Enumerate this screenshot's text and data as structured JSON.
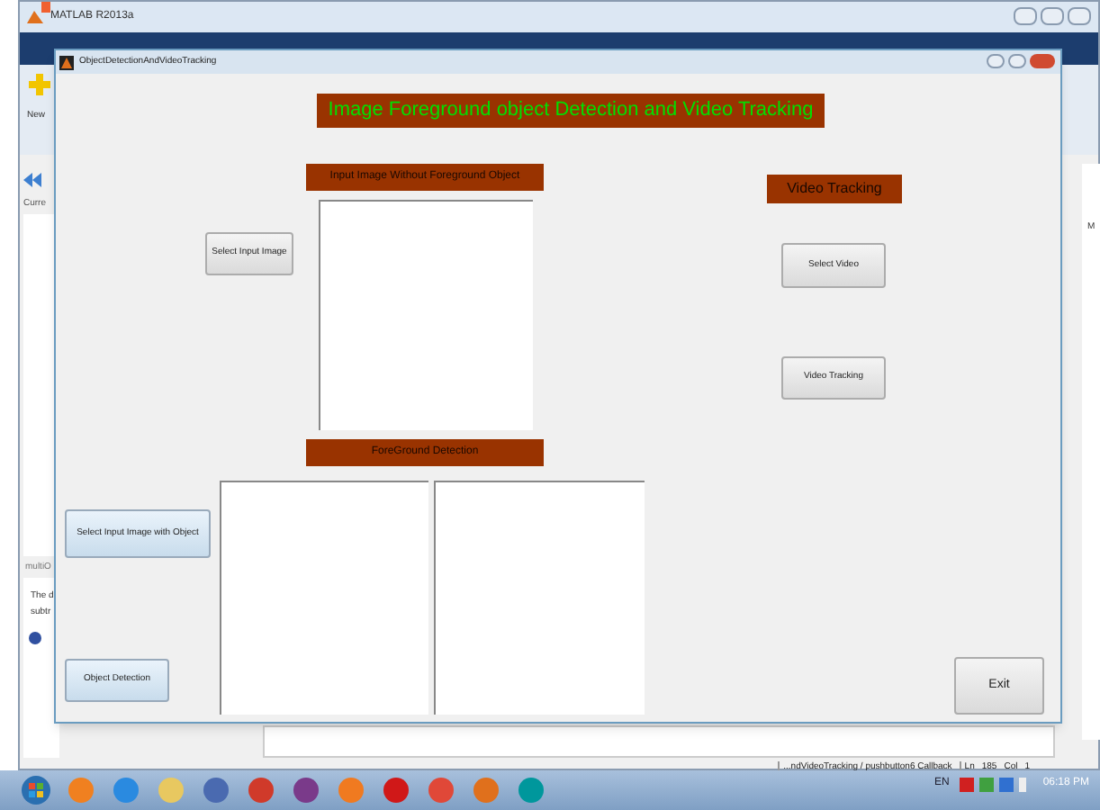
{
  "main_window": {
    "title": "MATLAB R2013a",
    "toolstrip": {
      "new_label": "New"
    },
    "left_panel": {
      "header": "Curre",
      "details_title": "multiO",
      "details_lines": [
        "The d",
        "subtr"
      ]
    },
    "right_panel": {
      "column_label": "M"
    },
    "status_bar": {
      "callback": "...ndVideoTracking / pushbutton6 Callback",
      "ln_label": "Ln",
      "ln": "185",
      "col_label": "Col",
      "col": "1"
    }
  },
  "figure": {
    "title": "ObjectDetectionAndVideoTracking",
    "banner": "Image Foreground object Detection and Video Tracking",
    "labels": [
      {
        "text": "Input Image Without Foreground Object",
        "kind": "section"
      },
      {
        "text": "Video Tracking",
        "kind": "heading"
      },
      {
        "text": "ForeGround Detection",
        "kind": "section"
      }
    ],
    "buttons": [
      {
        "label": "Select Input Image",
        "kind": "gray"
      },
      {
        "label": "Select Video",
        "kind": "gray"
      },
      {
        "label": "Video Tracking",
        "kind": "gray"
      },
      {
        "label": "Select Input Image with Object",
        "kind": "blue"
      },
      {
        "label": "Object Detection",
        "kind": "blue"
      },
      {
        "label": "Exit",
        "kind": "gray"
      }
    ]
  },
  "taskbar": {
    "language": "EN",
    "time": "06:18 PM"
  }
}
